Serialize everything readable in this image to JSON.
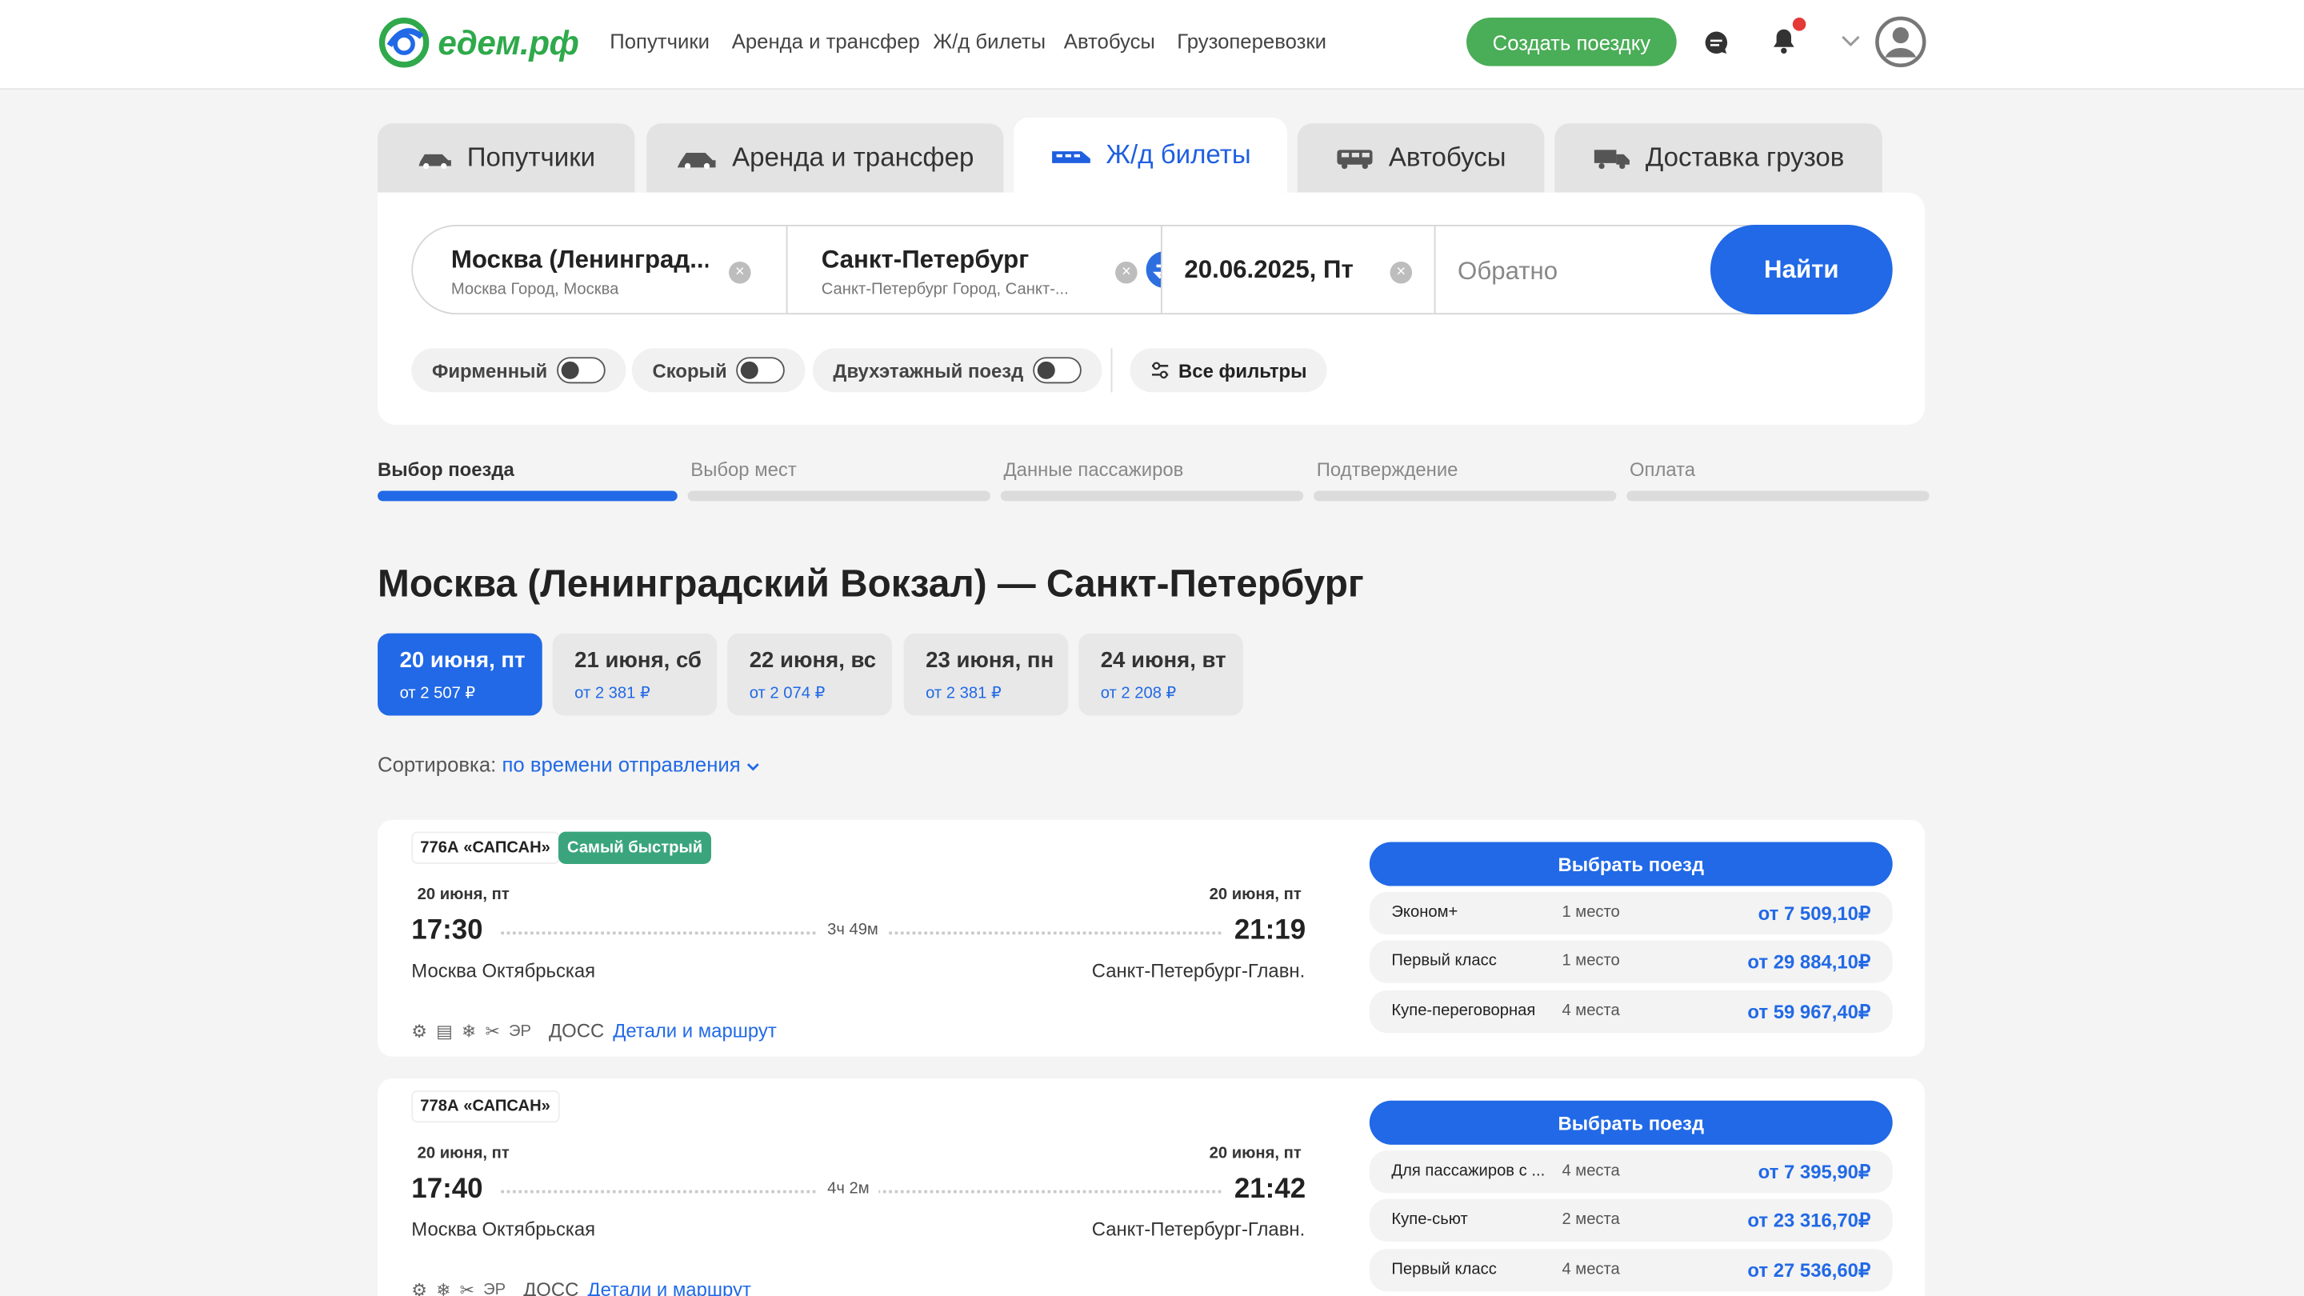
{
  "header": {
    "logo_text": "едем.рф",
    "nav": [
      "Попутчики",
      "Аренда и трансфер",
      "Ж/д билеты",
      "Автобусы",
      "Грузоперевозки"
    ],
    "create_trip": "Создать поездку",
    "colors": {
      "brand_green": "#4aad57",
      "accent_blue": "#2169e6",
      "notify_dot": "#e53935"
    }
  },
  "tabs": [
    {
      "label": "Попутчики",
      "icon": "car-icon"
    },
    {
      "label": "Аренда и трансфер",
      "icon": "car-rental-icon"
    },
    {
      "label": "Ж/д билеты",
      "icon": "train-icon",
      "active": true
    },
    {
      "label": "Автобусы",
      "icon": "bus-icon"
    },
    {
      "label": "Доставка грузов",
      "icon": "truck-icon"
    }
  ],
  "search": {
    "from_main": "Москва (Ленинград...",
    "from_sub": "Москва Город, Москва",
    "to_main": "Санкт-Петербург",
    "to_sub": "Санкт-Петербург Город, Санкт-...",
    "date": "20.06.2025, Пт",
    "return_placeholder": "Обратно",
    "find_button": "Найти",
    "filters": [
      "Фирменный",
      "Скорый",
      "Двухэтажный поезд"
    ],
    "all_filters": "Все фильтры"
  },
  "steps": [
    "Выбор поезда",
    "Выбор мест",
    "Данные пассажиров",
    "Подтверждение",
    "Оплата"
  ],
  "route_title": "Москва (Ленинградский Вокзал) — Санкт-Петербург",
  "dates": [
    {
      "label": "20 июня, пт",
      "price": "от 2 507 ₽",
      "active": true
    },
    {
      "label": "21 июня, сб",
      "price": "от 2 381 ₽"
    },
    {
      "label": "22 июня, вс",
      "price": "от 2 074 ₽"
    },
    {
      "label": "23 июня, пн",
      "price": "от 2 381 ₽"
    },
    {
      "label": "24 июня, вт",
      "price": "от 2 208 ₽"
    }
  ],
  "sort": {
    "label": "Сортировка:",
    "value": "по времени отправления"
  },
  "trains": [
    {
      "number": "776А «САПСАН»",
      "badge": "Самый быстрый",
      "dep_date": "20 июня, пт",
      "arr_date": "20 июня, пт",
      "dep_time": "17:30",
      "arr_time": "21:19",
      "duration": "3ч 49м",
      "dep_station": "Москва Октябрьская",
      "arr_station": "Санкт-Петербург-Главн.",
      "amenities": [
        "⚙",
        "▤",
        "❄",
        "✂",
        "ЭР"
      ],
      "doss": "ДОСС",
      "details": "Детали и маршрут",
      "select": "Выбрать поезд",
      "fares": [
        {
          "cls": "Эконом+",
          "seats": "1 место",
          "price": "от 7 509,10₽"
        },
        {
          "cls": "Первый класс",
          "seats": "1 место",
          "price": "от 29 884,10₽"
        },
        {
          "cls": "Купе-переговорная",
          "seats": "4 места",
          "price": "от 59 967,40₽"
        }
      ]
    },
    {
      "number": "778А «САПСАН»",
      "badge": "",
      "dep_date": "20 июня, пт",
      "arr_date": "20 июня, пт",
      "dep_time": "17:40",
      "arr_time": "21:42",
      "duration": "4ч 2м",
      "dep_station": "Москва Октябрьская",
      "arr_station": "Санкт-Петербург-Главн.",
      "amenities": [
        "⚙",
        "❄",
        "✂",
        "ЭР"
      ],
      "doss": "ДОСС",
      "details": "Детали и маршрут",
      "select": "Выбрать поезд",
      "fares": [
        {
          "cls": "Для пассажиров с ...",
          "seats": "4 места",
          "price": "от 7 395,90₽"
        },
        {
          "cls": "Купе-сьют",
          "seats": "2 места",
          "price": "от 23 316,70₽"
        },
        {
          "cls": "Первый класс",
          "seats": "4 места",
          "price": "от 27 536,60₽"
        }
      ]
    }
  ]
}
